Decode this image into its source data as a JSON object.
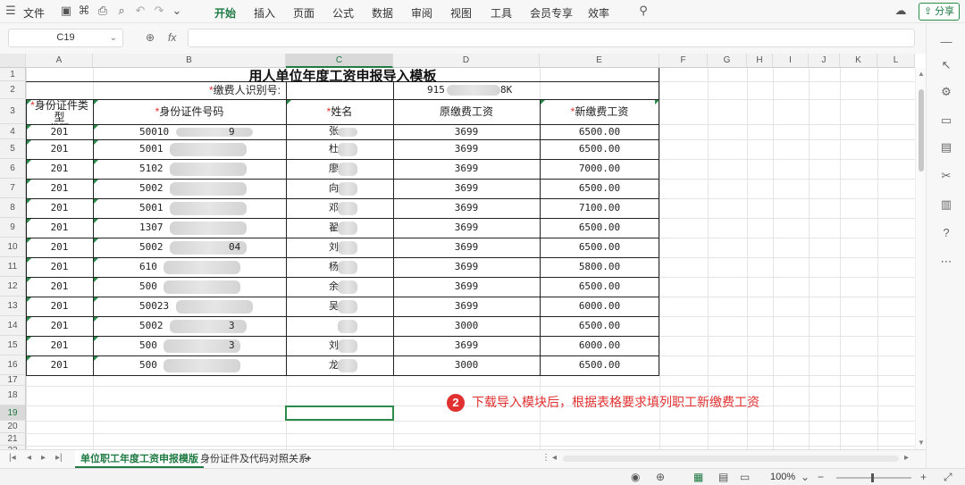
{
  "menubar": {
    "file_label": "文件",
    "tabs": [
      "开始",
      "插入",
      "页面",
      "公式",
      "数据",
      "审阅",
      "视图",
      "工具",
      "会员专享",
      "效率"
    ],
    "active_tab": "开始",
    "share_label": "分享"
  },
  "formula_bar": {
    "cell_ref": "C19",
    "fx_label": "fx",
    "value": ""
  },
  "columns": [
    "A",
    "B",
    "C",
    "D",
    "E",
    "F",
    "G",
    "H",
    "I",
    "J",
    "K",
    "L"
  ],
  "selected_column": "C",
  "rows": [
    "1",
    "2",
    "3",
    "4",
    "5",
    "6",
    "7",
    "8",
    "9",
    "10",
    "11",
    "12",
    "13",
    "14",
    "15",
    "16",
    "17",
    "18",
    "19",
    "20",
    "21",
    "22"
  ],
  "selected_row": "19",
  "sheet": {
    "title": "用人单位年度工资申报导入模板",
    "payer_id_label": "缴费人识别号:",
    "payer_id_value_prefix": "915",
    "payer_id_value_suffix": "8K",
    "required_mark": "*",
    "headers": [
      "身份证件类型代码",
      "身份证件号码",
      "姓名",
      "原缴费工资",
      "新缴费工资"
    ],
    "header_a_line1": "身份证件类型",
    "header_a_line2": "代码",
    "records": [
      {
        "type": "201",
        "id": "50010",
        "id_tail": "9",
        "name": "张",
        "old": "3699",
        "new": "6500.00"
      },
      {
        "type": "201",
        "id": "5001",
        "id_tail": "",
        "name": "杜",
        "old": "3699",
        "new": "6500.00"
      },
      {
        "type": "201",
        "id": "5102",
        "id_tail": "",
        "name": "廖",
        "old": "3699",
        "new": "7000.00"
      },
      {
        "type": "201",
        "id": "5002",
        "id_tail": "",
        "name": "向",
        "old": "3699",
        "new": "6500.00"
      },
      {
        "type": "201",
        "id": "5001",
        "id_tail": "",
        "name": "邓",
        "old": "3699",
        "new": "7100.00"
      },
      {
        "type": "201",
        "id": "1307",
        "id_tail": "",
        "name": "翟",
        "old": "3699",
        "new": "6500.00"
      },
      {
        "type": "201",
        "id": "5002",
        "id_tail": "04",
        "name": "刘",
        "old": "3699",
        "new": "6500.00"
      },
      {
        "type": "201",
        "id": "610",
        "id_tail": "",
        "name": "杨",
        "old": "3699",
        "new": "5800.00"
      },
      {
        "type": "201",
        "id": "500",
        "id_tail": "",
        "name": "余",
        "old": "3699",
        "new": "6500.00"
      },
      {
        "type": "201",
        "id": "50023",
        "id_tail": "",
        "name": "吴",
        "old": "3699",
        "new": "6000.00"
      },
      {
        "type": "201",
        "id": "5002",
        "id_tail": "3",
        "name": "",
        "old": "3000",
        "new": "6500.00"
      },
      {
        "type": "201",
        "id": "500",
        "id_tail": "3",
        "name": "刘",
        "old": "3699",
        "new": "6000.00"
      },
      {
        "type": "201",
        "id": "500",
        "id_tail": "",
        "name": "龙",
        "old": "3000",
        "new": "6500.00"
      }
    ]
  },
  "annotation": {
    "number": "2",
    "text": "下载导入模块后，根据表格要求填列职工新缴费工资"
  },
  "sheet_tabs": [
    "单位职工年度工资申报模版",
    "身份证件及代码对照关系"
  ],
  "active_sheet_tab": "单位职工年度工资申报模版",
  "add_sheet_label": "+",
  "status_bar": {
    "zoom": "100%"
  },
  "colors": {
    "accent": "#1f7a44",
    "required": "#e03030",
    "annotation": "#e03030"
  }
}
